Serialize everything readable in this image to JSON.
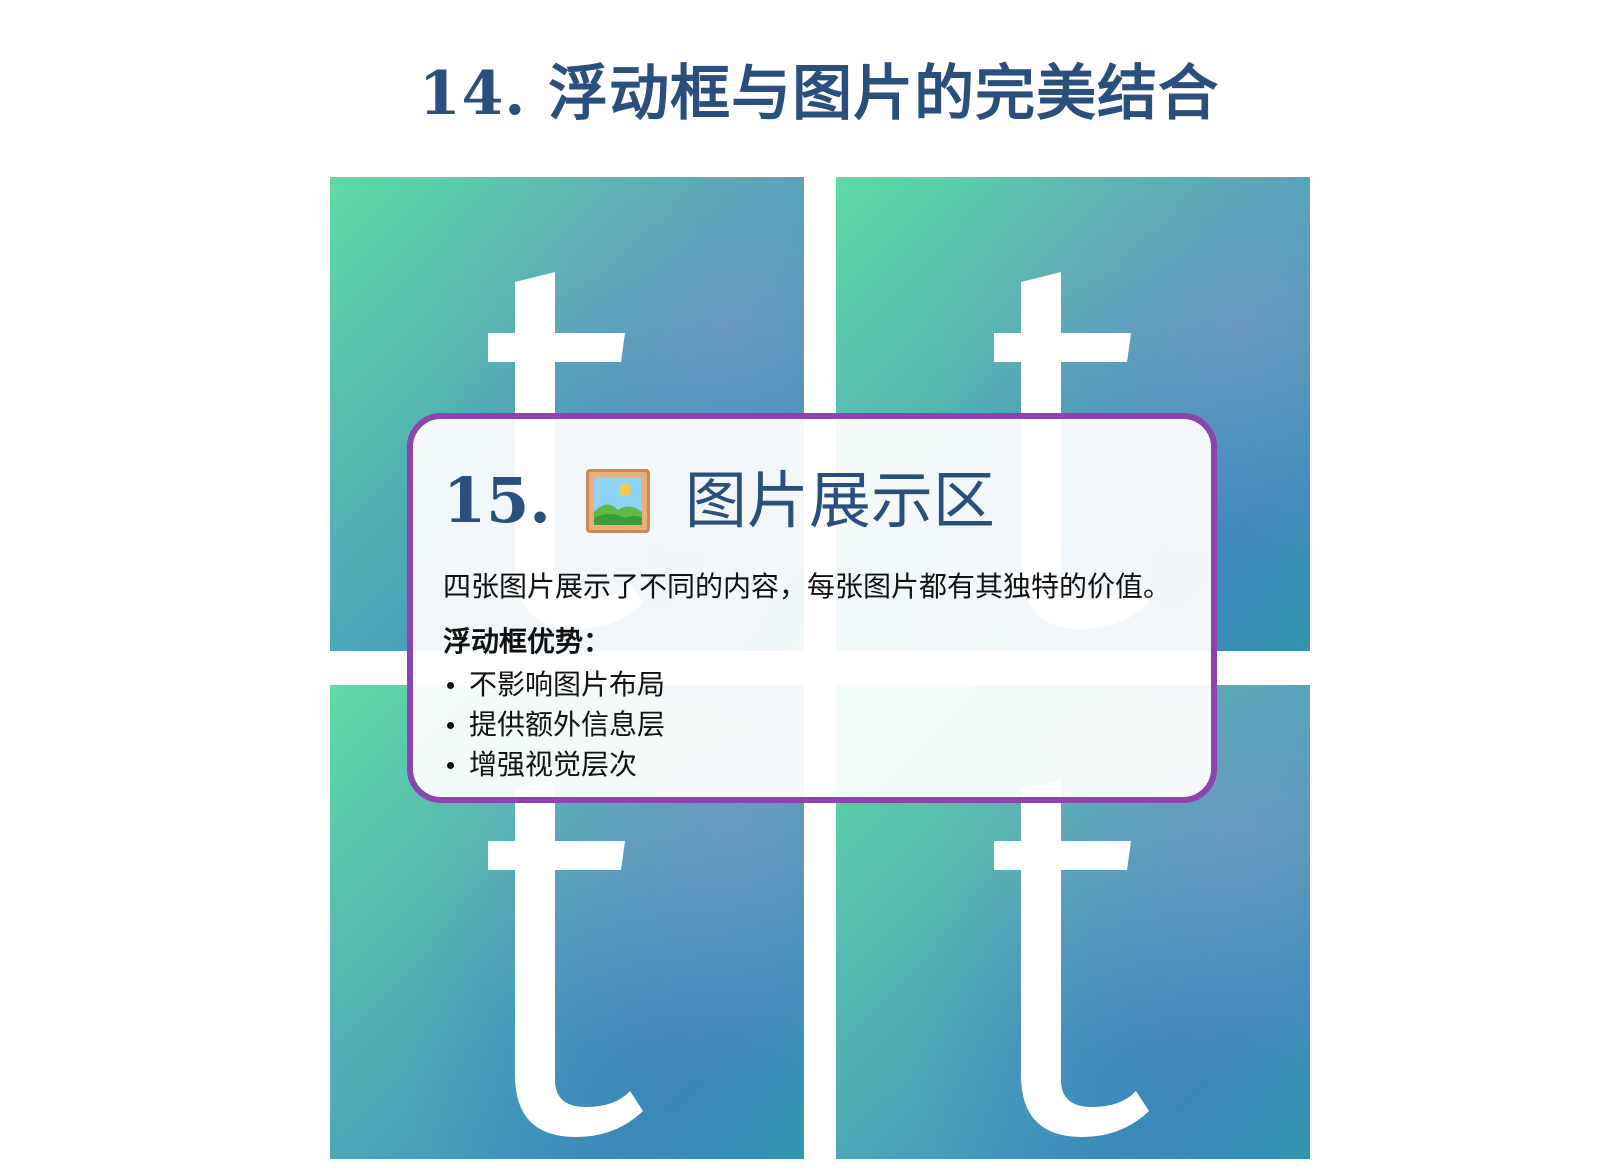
{
  "page": {
    "title": "14. 浮动框与图片的完美结合"
  },
  "images": {
    "count": 4,
    "glyph": "t",
    "colors": {
      "gradient_start": "#5edba6",
      "gradient_mid": "#4aa3b8",
      "gradient_end": "#2f9ea9",
      "glyph": "#ffffff"
    }
  },
  "float_box": {
    "number": "15.",
    "icon": "framed-picture-icon",
    "heading": "图片展示区",
    "description": "四张图片展示了不同的内容，每张图片都有其独特的价值。",
    "advantages_title": "浮动框优势：",
    "advantages": [
      "不影响图片布局",
      "提供额外信息层",
      "增强视觉层次"
    ],
    "colors": {
      "border": "#8e44ad",
      "heading": "#2a4f7c",
      "text": "#111111"
    }
  }
}
